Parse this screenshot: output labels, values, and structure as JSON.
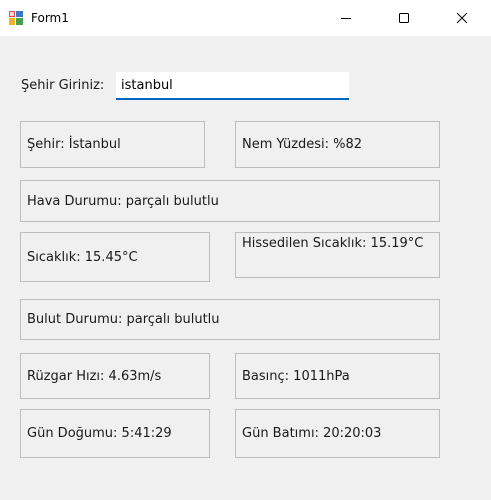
{
  "window": {
    "title": "Form1"
  },
  "form": {
    "city_label": "Şehir Giriniz:",
    "city_value": "istanbul"
  },
  "results": {
    "city": "Şehir: İstanbul",
    "humidity": "Nem Yüzdesi: %82",
    "weather": "Hava Durumu: parçalı bulutlu",
    "temperature": "Sıcaklık: 15.45°C",
    "feels_like": "Hissedilen Sıcaklık: 15.19°C",
    "clouds": "Bulut Durumu: parçalı bulutlu",
    "wind": "Rüzgar Hızı: 4.63m/s",
    "pressure": "Basınç: 1011hPa",
    "sunrise": "Gün Doğumu: 5:41:29",
    "sunset": "Gün Batımı: 20:20:03"
  },
  "colors": {
    "form_background": "#f0f0f0",
    "titlebar_background": "#ffffff",
    "input_accent": "#0067c0",
    "box_border": "#bdbdbd"
  },
  "icons": {
    "app": "windows-forms-app-icon",
    "minimize": "minimize-icon",
    "maximize": "maximize-icon",
    "close": "close-icon"
  }
}
